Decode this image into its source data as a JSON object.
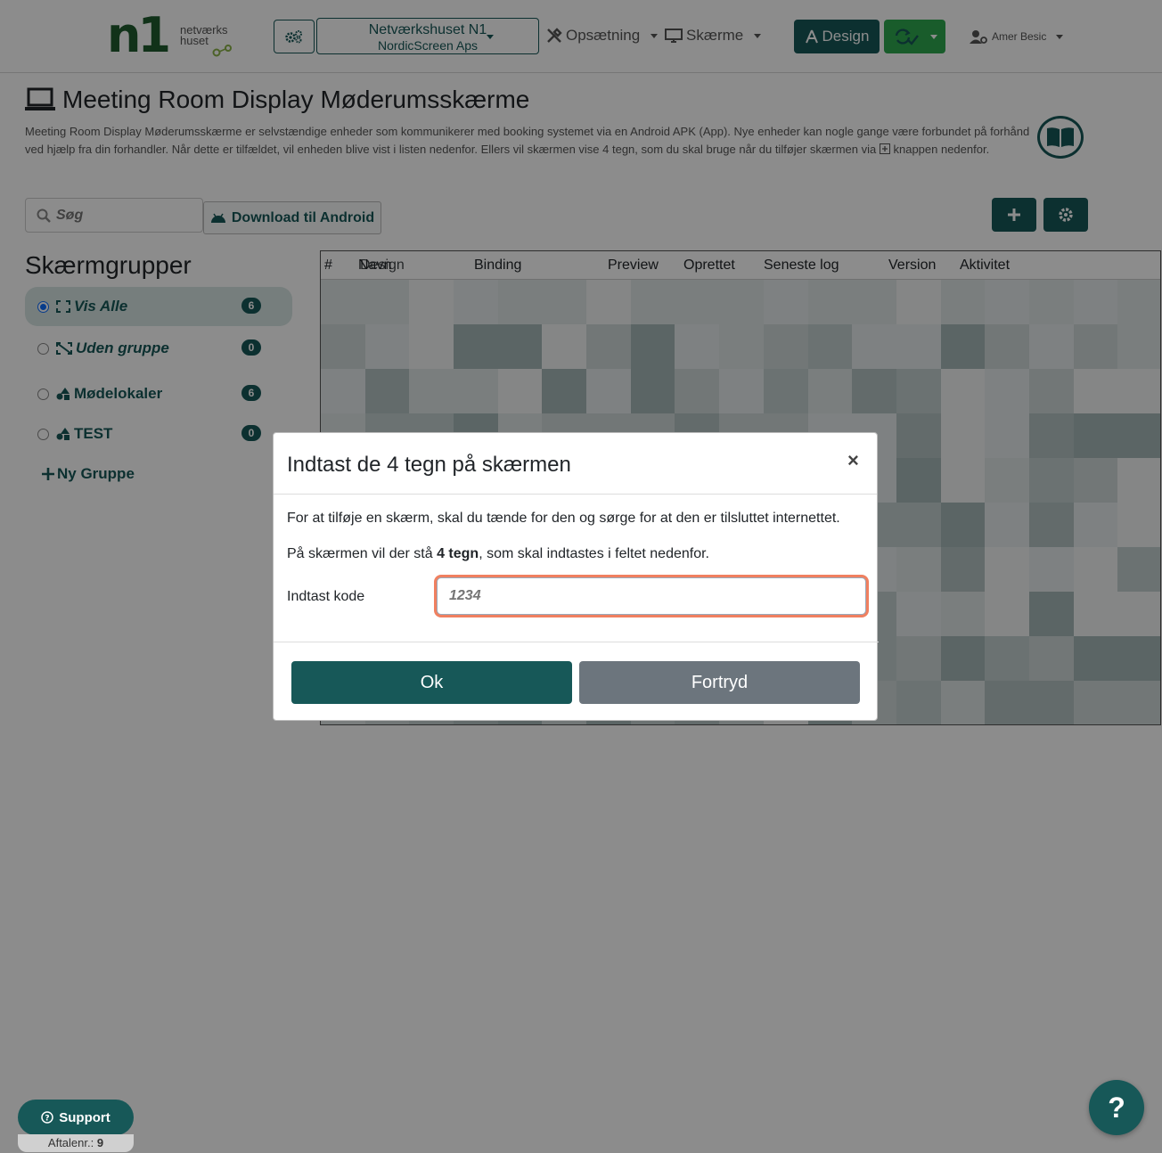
{
  "header": {
    "logo_sub_line1": "netværks",
    "logo_sub_line2": "huset",
    "org_name": "Netværkshuset N1",
    "org_sub": "NordicScreen Aps",
    "nav_setup": "Opsætning",
    "nav_screens": "Skærme",
    "design_label": "Design",
    "user_name": "Amer Besic"
  },
  "page": {
    "title": "Meeting Room Display Møderumsskærme",
    "description_before": "Meeting Room Display Møderumsskærme er selvstændige enheder som kommunikerer med booking systemet via en Android APK (App). Nye enheder kan nogle gange være forbundet på forhånd ved hjælp fra din forhandler. Når dette er tilfældet, vil enheden blive vist i listen nedenfor. Ellers vil skærmen vise 4 tegn, som du skal bruge når du tilføjer skærmen via",
    "description_after": "knappen nedenfor.",
    "search_placeholder": "Søg",
    "android_label": "Download til Android"
  },
  "groups": {
    "title": "Skærmgrupper",
    "items": [
      {
        "label": "Vis Alle",
        "count": "6"
      },
      {
        "label": "Uden gruppe",
        "count": "0"
      },
      {
        "label": "Mødelokaler",
        "count": "6"
      },
      {
        "label": "TEST",
        "count": "0"
      }
    ],
    "new_group": "Ny Gruppe"
  },
  "table": {
    "columns": [
      "#",
      "Navn",
      "Design",
      "Binding",
      "Preview",
      "Oprettet",
      "Seneste log",
      "Version",
      "Aktivitet"
    ]
  },
  "modal": {
    "title": "Indtast de 4 tegn på skærmen",
    "close": "×",
    "line1": "For at tilføje en skærm, skal du tænde for den og sørge for at den er tilsluttet internettet.",
    "line2_before": "På skærmen vil der stå ",
    "line2_bold": "4 tegn",
    "line2_after": ", som skal indtastes i feltet nedenfor.",
    "code_label": "Indtast kode",
    "code_placeholder": "1234",
    "ok": "Ok",
    "cancel": "Fortryd"
  },
  "footer": {
    "support": "Support",
    "contract_label": "Aftalenr.:",
    "contract_number": "9",
    "help": "?"
  },
  "colors": {
    "primary": "#175858",
    "success": "#2fa84f",
    "secondary": "#6c757d",
    "focus_ring": "#f08060"
  }
}
